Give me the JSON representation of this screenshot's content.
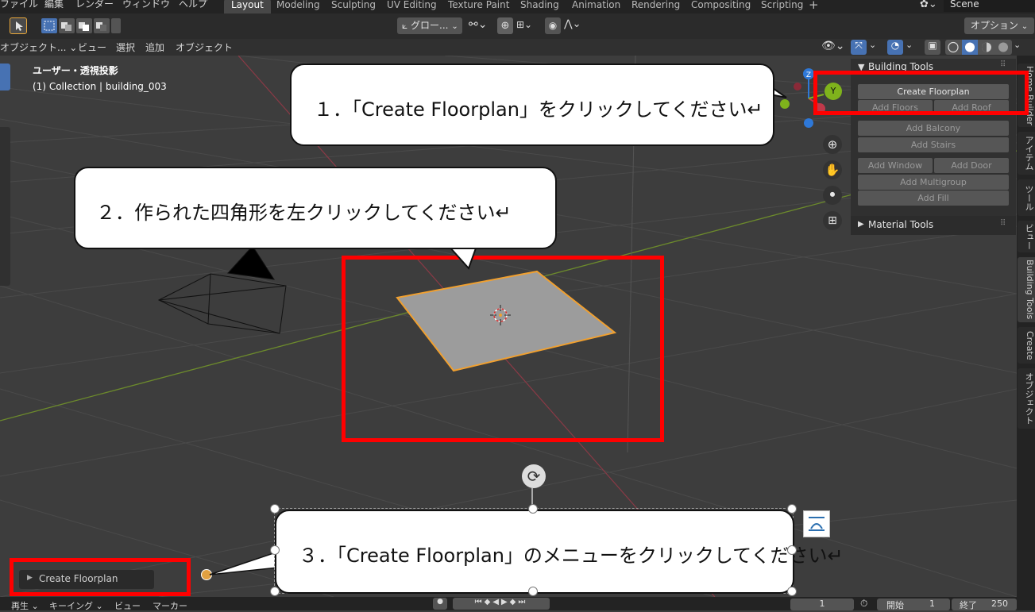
{
  "menu": {
    "file": "ファイル",
    "edit": "編集",
    "render": "レンダー",
    "window": "ウィンドウ",
    "help": "ヘルプ"
  },
  "workspaces": [
    "Layout",
    "Modeling",
    "Sculpting",
    "UV Editing",
    "Texture Paint",
    "Shading",
    "Animation",
    "Rendering",
    "Compositing",
    "Scripting"
  ],
  "scene_name": "Scene",
  "header": {
    "transform_orientation": "グロー...",
    "options": "オプション"
  },
  "viewport_header": {
    "mode": "オブジェクト...",
    "view": "ビュー",
    "select": "選択",
    "add": "追加",
    "object": "オブジェクト"
  },
  "viewport": {
    "view_name": "ユーザー・透視投影",
    "collection_info": "(1) Collection | building_003",
    "gizmo_x": "X",
    "gizmo_y": "Y",
    "gizmo_z": "Z"
  },
  "npanel": {
    "building_tools_title": "Building Tools",
    "material_tools_title": "Material Tools",
    "create_floorplan": "Create Floorplan",
    "add_floors": "Add Floors",
    "add_roof": "Add Roof",
    "add_balcony": "Add Balcony",
    "add_stairs": "Add Stairs",
    "add_window": "Add Window",
    "add_door": "Add Door",
    "add_multigroup": "Add Multigroup",
    "add_fill": "Add Fill"
  },
  "side_tabs": [
    "Home Builder",
    "アイテム",
    "ツール",
    "ビュー",
    "Building Tools",
    "Create",
    "オブジェクト"
  ],
  "operator_panel": {
    "label": "Create Floorplan"
  },
  "callouts": {
    "step1": "１．「Create Floorplan」をクリックしてください↵",
    "step2": "２．作られた四角形を左クリックしてください↵",
    "step3": "３．「Create Floorplan」のメニューをクリックしてください↵"
  },
  "timeline": {
    "playback": "再生",
    "keying": "キーイング",
    "view": "ビュー",
    "marker": "マーカー",
    "current_frame": "1",
    "start_label": "開始",
    "start_value": "1",
    "end_label": "終了",
    "end_value": "250"
  },
  "colors": {
    "highlight_red": "#ff0000",
    "selection_orange": "#f0a030",
    "x_axis": "#c0394a",
    "y_axis": "#7fb31c",
    "z_axis": "#2e78d8"
  }
}
